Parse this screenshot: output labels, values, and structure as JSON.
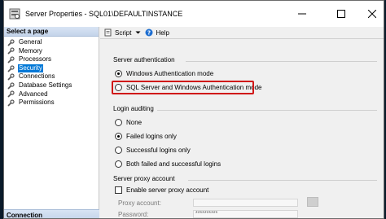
{
  "window": {
    "title": "Server Properties - SQL01\\DEFAULTINSTANCE"
  },
  "sidebar": {
    "header": "Select a page",
    "items": [
      {
        "label": "General",
        "active": false
      },
      {
        "label": "Memory",
        "active": false
      },
      {
        "label": "Processors",
        "active": false
      },
      {
        "label": "Security",
        "active": true
      },
      {
        "label": "Connections",
        "active": false
      },
      {
        "label": "Database Settings",
        "active": false
      },
      {
        "label": "Advanced",
        "active": false
      },
      {
        "label": "Permissions",
        "active": false
      }
    ],
    "connection_header": "Connection"
  },
  "toolbar": {
    "script_label": "Script",
    "help_label": "Help"
  },
  "server_auth": {
    "title": "Server authentication",
    "options": [
      {
        "label": "Windows Authentication mode",
        "checked": true
      },
      {
        "label": "SQL Server and Windows Authentication mode",
        "checked": false
      }
    ]
  },
  "login_auditing": {
    "title": "Login auditing",
    "options": [
      {
        "label": "None",
        "checked": false
      },
      {
        "label": "Failed logins only",
        "checked": true
      },
      {
        "label": "Successful logins only",
        "checked": false
      },
      {
        "label": "Both failed and successful logins",
        "checked": false
      }
    ]
  },
  "proxy": {
    "title": "Server proxy account",
    "enable_label": "Enable server proxy account",
    "enable_checked": false,
    "account_label": "Proxy account:",
    "account_value": "",
    "password_label": "Password:",
    "password_value": "**********"
  },
  "colors": {
    "selection": "#0078d7",
    "highlight_border": "#d01818"
  }
}
